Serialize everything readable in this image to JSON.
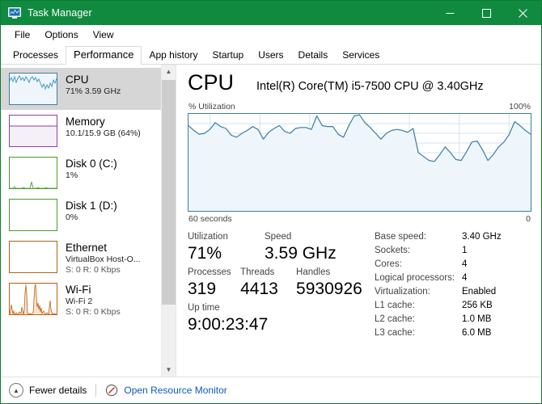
{
  "window": {
    "title": "Task Manager",
    "icon": "task-manager-icon",
    "accent_color": "#108a3e",
    "buttons": {
      "minimize": "minimize-icon",
      "maximize": "maximize-icon",
      "close": "close-icon"
    }
  },
  "menu": {
    "items": [
      "File",
      "Options",
      "View"
    ]
  },
  "tabs": {
    "items": [
      {
        "label": "Processes",
        "active": false
      },
      {
        "label": "Performance",
        "active": true
      },
      {
        "label": "App history",
        "active": false
      },
      {
        "label": "Startup",
        "active": false
      },
      {
        "label": "Users",
        "active": false
      },
      {
        "label": "Details",
        "active": false
      },
      {
        "label": "Services",
        "active": false
      }
    ]
  },
  "sidebar": {
    "items": [
      {
        "name": "CPU",
        "line1": "71%  3.59 GHz",
        "line2": "",
        "selected": true,
        "color": "#3a7ea8",
        "fill": "#eaf3fa",
        "graph": "jagged-high"
      },
      {
        "name": "Memory",
        "line1": "10.1/15.9 GB (64%)",
        "line2": "",
        "selected": false,
        "color": "#8a3fa8",
        "fill": "#f3eef5",
        "graph": "flat-64"
      },
      {
        "name": "Disk 0 (C:)",
        "line1": "1%",
        "line2": "",
        "selected": false,
        "color": "#4c9a2a",
        "fill": "#ffffff",
        "graph": "low-spikes"
      },
      {
        "name": "Disk 1 (D:)",
        "line1": "0%",
        "line2": "",
        "selected": false,
        "color": "#4c9a2a",
        "fill": "#ffffff",
        "graph": "empty"
      },
      {
        "name": "Ethernet",
        "line1": "VirtualBox Host-O...",
        "line2": "S: 0 R: 0 Kbps",
        "selected": false,
        "color": "#a9631a",
        "fill": "#ffffff",
        "graph": "empty"
      },
      {
        "name": "Wi-Fi",
        "line1": "Wi-Fi 2",
        "line2": "S: 0 R: 0 Kbps",
        "selected": false,
        "color": "#c0600f",
        "fill": "#ffffff",
        "graph": "spiky-net"
      }
    ],
    "scrollbar": {
      "up": "chevron-up-icon",
      "down": "chevron-down-icon"
    }
  },
  "main": {
    "title": "CPU",
    "subtitle": "Intel(R) Core(TM) i5-7500 CPU @ 3.40GHz",
    "graph": {
      "y_label": "% Utilization",
      "y_max_label": "100%",
      "x_left_label": "60 seconds",
      "x_right_label": "0",
      "line_color": "#3a7ea8",
      "fill_color": "#eef5fb",
      "grid_color": "#d3e3ef"
    },
    "stats": {
      "row1": [
        {
          "label": "Utilization",
          "value": "71%",
          "width": 95
        },
        {
          "label": "Speed",
          "value": "3.59 GHz",
          "width": 130
        }
      ],
      "row2": [
        {
          "label": "Processes",
          "value": "319",
          "width": 68
        },
        {
          "label": "Threads",
          "value": "4413",
          "width": 72
        },
        {
          "label": "Handles",
          "value": "5930926",
          "width": 90
        }
      ],
      "row3": [
        {
          "label": "Up time",
          "value": "9:00:23:47",
          "width": 160
        }
      ]
    },
    "system_info": [
      {
        "label": "Base speed:",
        "value": "3.40 GHz"
      },
      {
        "label": "Sockets:",
        "value": "1"
      },
      {
        "label": "Cores:",
        "value": "4"
      },
      {
        "label": "Logical processors:",
        "value": "4"
      },
      {
        "label": "Virtualization:",
        "value": "Enabled"
      },
      {
        "label": "L1 cache:",
        "value": "256 KB"
      },
      {
        "label": "L2 cache:",
        "value": "1.0 MB"
      },
      {
        "label": "L3 cache:",
        "value": "6.0 MB"
      }
    ]
  },
  "statusbar": {
    "fewer_details": "Fewer details",
    "fewer_details_icon": "chevron-up-circle-icon",
    "resource_monitor": "Open Resource Monitor",
    "resource_monitor_icon": "resource-monitor-icon",
    "link_color": "#0a5bbf"
  },
  "chart_data": {
    "type": "area",
    "title": "CPU % Utilization",
    "xlabel": "60 seconds",
    "ylabel": "% Utilization",
    "ylim": [
      0,
      100
    ],
    "xlim": [
      60,
      0
    ],
    "grid": true,
    "series": [
      {
        "name": "CPU Utilization",
        "values": [
          88,
          83,
          79,
          80,
          84,
          91,
          87,
          85,
          78,
          76,
          80,
          83,
          87,
          84,
          74,
          81,
          85,
          88,
          82,
          80,
          85,
          86,
          86,
          84,
          98,
          88,
          87,
          87,
          79,
          76,
          88,
          98,
          99,
          91,
          86,
          80,
          74,
          80,
          83,
          84,
          83,
          81,
          85,
          60,
          56,
          52,
          51,
          58,
          66,
          60,
          53,
          52,
          61,
          71,
          72,
          63,
          52,
          58,
          66,
          71,
          79,
          92,
          88,
          83,
          79
        ]
      }
    ]
  }
}
